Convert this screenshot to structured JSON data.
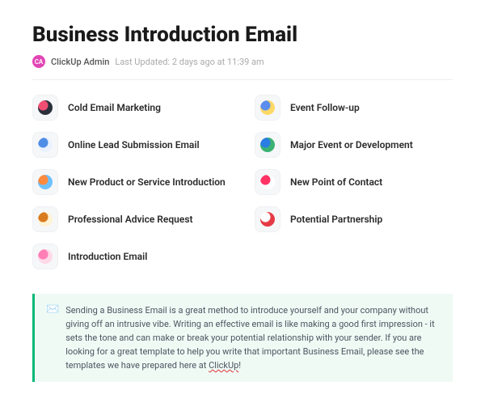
{
  "title": "Business Introduction Email",
  "meta": {
    "avatar_initials": "CA",
    "author": "ClickUp Admin",
    "updated": "Last Updated: 2 days ago at 11:39 am"
  },
  "items": [
    {
      "label": "Cold Email Marketing",
      "icon": "cold-email-icon",
      "bg": "#2a2f3a",
      "fg": "#f24e73"
    },
    {
      "label": "Event Follow-up",
      "icon": "event-followup-icon",
      "bg": "#ffd966",
      "fg": "#5b8def"
    },
    {
      "label": "Online Lead Submission Email",
      "icon": "lead-submission-icon",
      "bg": "#eaf2ff",
      "fg": "#4e8de6"
    },
    {
      "label": "Major Event or Development",
      "icon": "major-event-icon",
      "bg": "#3bb273",
      "fg": "#2a7de1"
    },
    {
      "label": "New Product or Service Introduction",
      "icon": "new-product-icon",
      "bg": "#6ec1ff",
      "fg": "#ff8a3d"
    },
    {
      "label": "New Point of Contact",
      "icon": "new-contact-icon",
      "bg": "#ffffff",
      "fg": "#ff3366"
    },
    {
      "label": "Professional Advice Request",
      "icon": "advice-icon",
      "bg": "#fff3d6",
      "fg": "#d97b1f"
    },
    {
      "label": "Potential Partnership",
      "icon": "partnership-icon",
      "bg": "#e63946",
      "fg": "#ffffff"
    },
    {
      "label": "Introduction Email",
      "icon": "intro-email-icon",
      "bg": "#ffd9e8",
      "fg": "#ff7eb6"
    }
  ],
  "callout": {
    "emoji": "✉️",
    "pre_text": "Sending a Business Email is a great method to introduce yourself and your company without giving off an intrusive vibe. Writing an effective email is like making a good first impression - it sets the tone and can make or break your potential relationship with your sender. If you are looking for a great template to help you write that important Business Email, please see the templates we have prepared here at ",
    "squiggle_text": "ClickUp",
    "post_text": "!"
  }
}
